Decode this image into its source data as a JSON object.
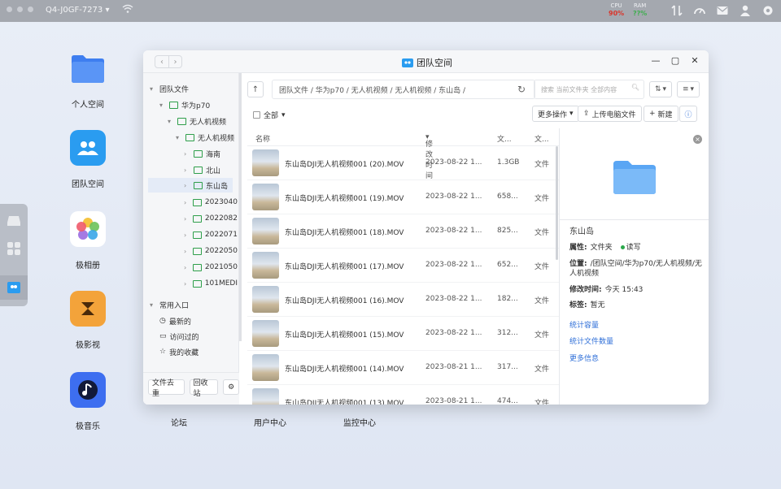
{
  "topbar": {
    "device_name": "Q4-J0GF-7273",
    "cpu_label": "CPU",
    "cpu_value": "90%",
    "ram_label": "RAM",
    "ram_value": "??%"
  },
  "desktop": {
    "personal_space": "个人空间",
    "team_space": "团队空间",
    "photos": "极相册",
    "video": "极影视",
    "music": "极音乐",
    "forum": "论坛",
    "user_center": "用户中心",
    "monitor_center": "监控中心"
  },
  "window": {
    "title": "团队空间",
    "sidebar": {
      "team_files": "团队文件",
      "huawei": "华为p70",
      "drone_video": "无人机视频",
      "drone_video2": "无人机视频",
      "folders": [
        "海南",
        "北山",
        "东山岛",
        "2023040",
        "2022082",
        "2022071",
        "2022050",
        "2021050",
        "101MEDI"
      ],
      "common": "常用入口",
      "recent": "最新的",
      "visited": "访问过的",
      "favorites": "我的收藏",
      "dedupe": "文件去重",
      "recycle": "回收站"
    },
    "toolbar": {
      "breadcrumb": "团队文件 / 华为p70 / 无人机视频 / 无人机视频 / 东山岛 /",
      "search_placeholder": "搜索 当前文件夹 全部内容",
      "select_all": "全部",
      "more_actions": "更多操作",
      "upload": "上传电脑文件",
      "new": "新建"
    },
    "columns": {
      "name": "名称",
      "modified": "修改时间",
      "size": "文...",
      "type": "文..."
    },
    "files": [
      {
        "name": "东山岛DJI无人机视频001 (20).MOV",
        "date": "2023-08-22 1...",
        "size": "1.3GB",
        "type": "文件"
      },
      {
        "name": "东山岛DJI无人机视频001 (19).MOV",
        "date": "2023-08-22 1...",
        "size": "658...",
        "type": "文件"
      },
      {
        "name": "东山岛DJI无人机视频001 (18).MOV",
        "date": "2023-08-22 1...",
        "size": "825...",
        "type": "文件"
      },
      {
        "name": "东山岛DJI无人机视频001 (17).MOV",
        "date": "2023-08-22 1...",
        "size": "652...",
        "type": "文件"
      },
      {
        "name": "东山岛DJI无人机视频001 (16).MOV",
        "date": "2023-08-22 1...",
        "size": "182...",
        "type": "文件"
      },
      {
        "name": "东山岛DJI无人机视频001 (15).MOV",
        "date": "2023-08-22 1...",
        "size": "312...",
        "type": "文件"
      },
      {
        "name": "东山岛DJI无人机视频001 (14).MOV",
        "date": "2023-08-21 1...",
        "size": "317...",
        "type": "文件"
      },
      {
        "name": "东山岛DJI无人机视频001 (13).MOV",
        "date": "2023-08-21 1...",
        "size": "474...",
        "type": "文件"
      }
    ],
    "detail": {
      "name": "东山岛",
      "attr_label": "属性:",
      "attr_value": "文件夹",
      "perm": "读写",
      "loc_label": "位置:",
      "loc_value": "/团队空间/华为p70/无人机视频/无人机视频",
      "mod_label": "修改时间:",
      "mod_value": "今天 15:43",
      "tag_label": "标签:",
      "tag_value": "暂无",
      "stat_capacity": "统计容量",
      "stat_count": "统计文件数量",
      "more_info": "更多信息"
    }
  }
}
